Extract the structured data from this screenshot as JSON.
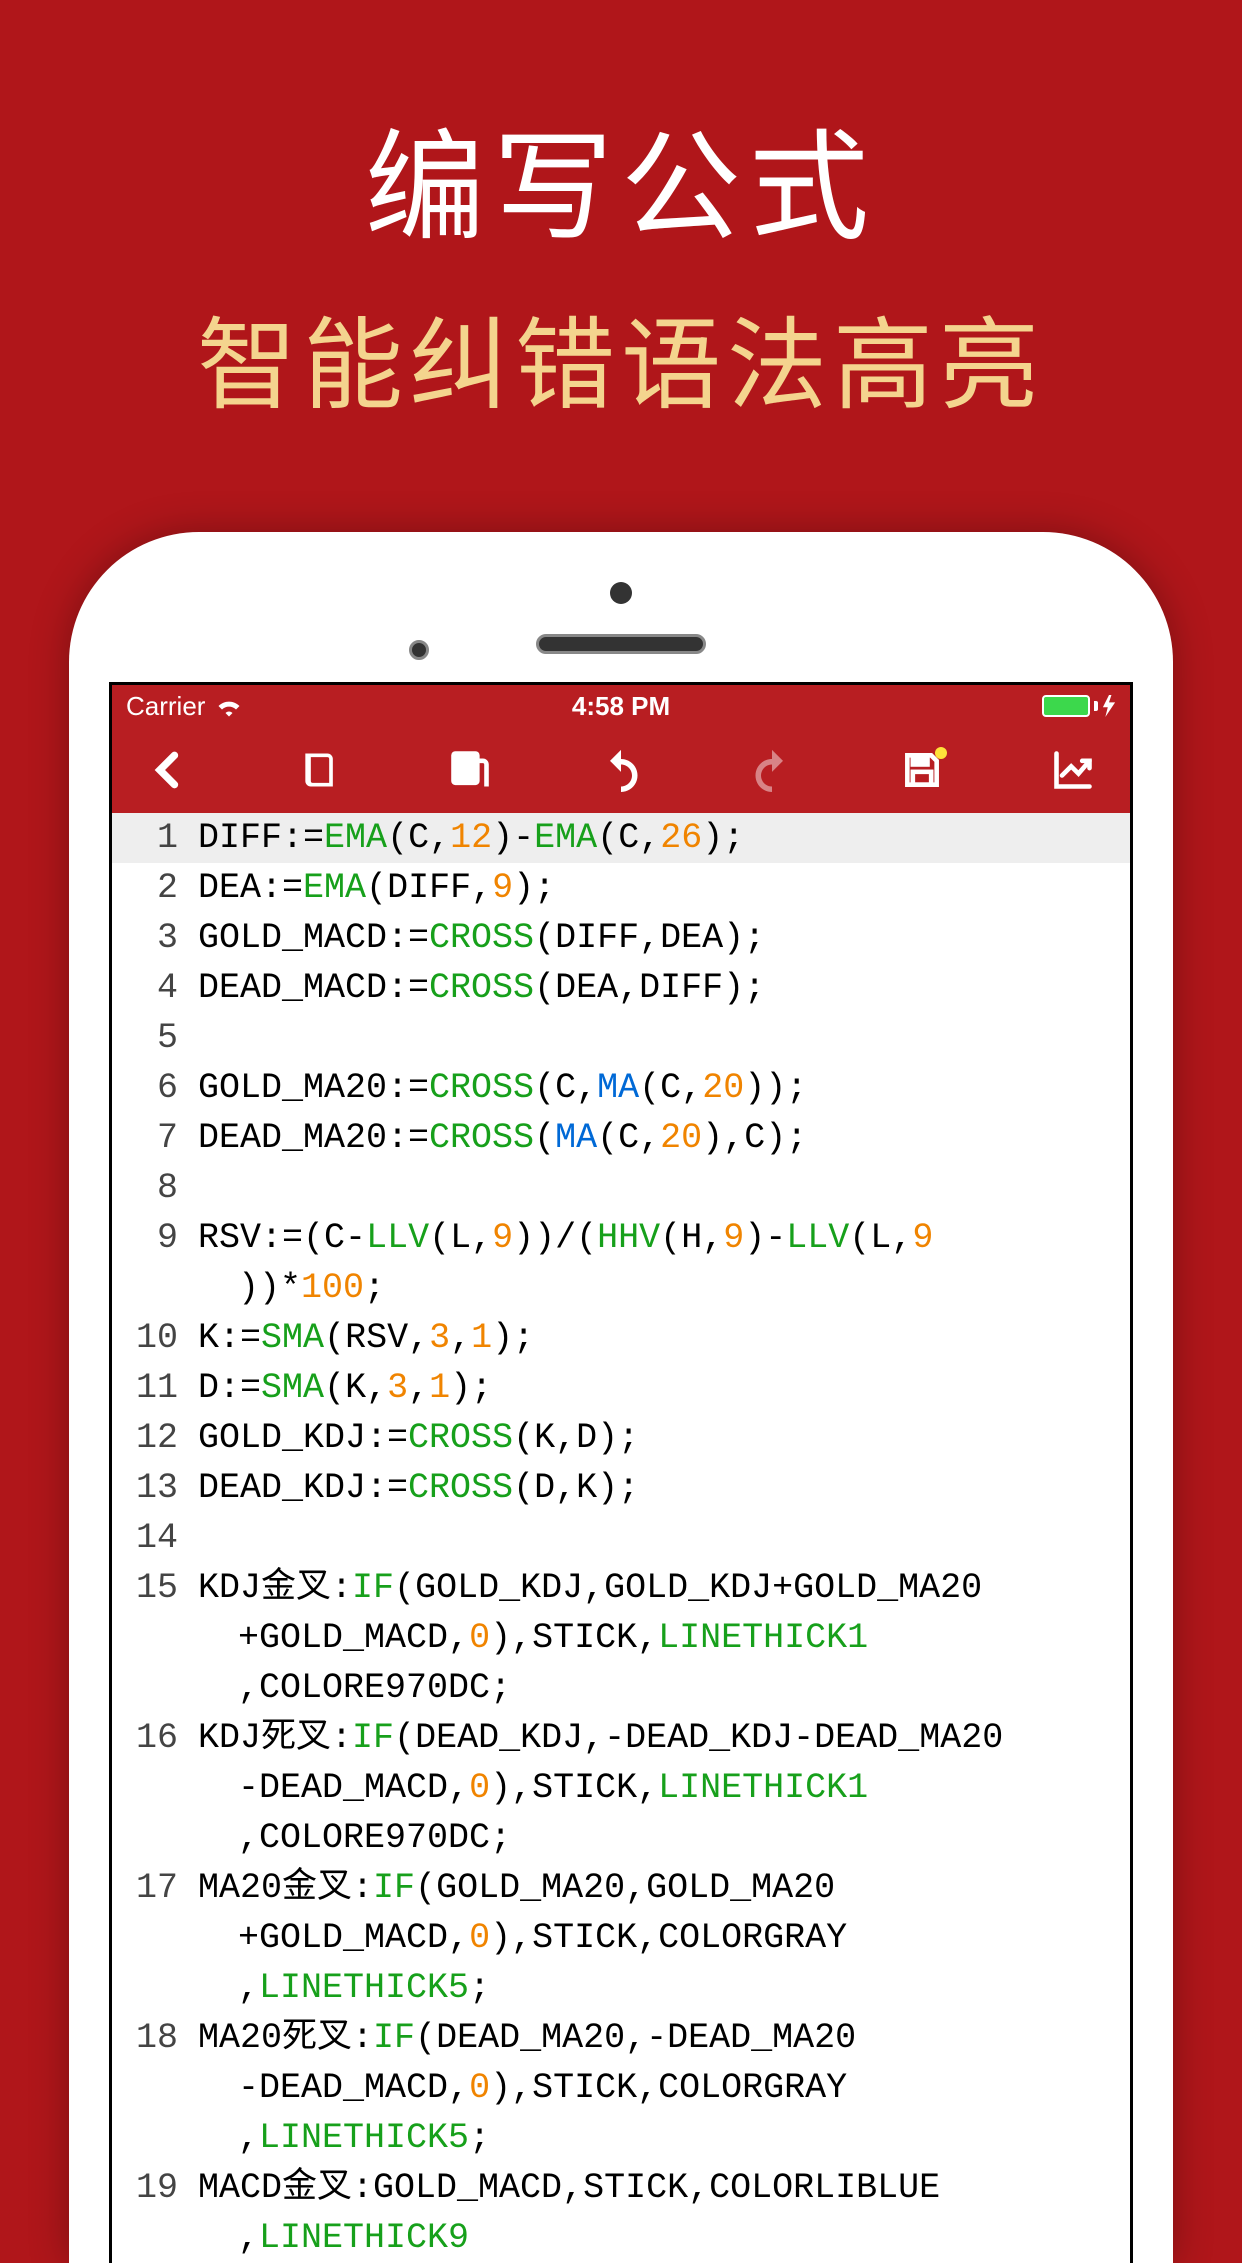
{
  "promo": {
    "title": "编写公式",
    "subtitle": "智能纠错语法高亮"
  },
  "status": {
    "carrier": "Carrier",
    "time": "4:58 PM"
  },
  "toolbar": {
    "back": "back-icon",
    "book": "book-icon",
    "copy": "copy-icon",
    "undo": "undo-icon",
    "redo": "redo-icon",
    "save": "save-icon",
    "chart": "chart-icon"
  },
  "code_lines": [
    {
      "n": 1,
      "active": true,
      "tokens": [
        {
          "t": "id",
          "v": "DIFF"
        },
        {
          "t": "punc",
          "v": ":"
        },
        {
          "t": "op",
          "v": "="
        },
        {
          "t": "fn",
          "v": "EMA"
        },
        {
          "t": "punc",
          "v": "("
        },
        {
          "t": "id",
          "v": "C"
        },
        {
          "t": "punc",
          "v": ","
        },
        {
          "t": "num",
          "v": "12"
        },
        {
          "t": "punc",
          "v": ")"
        },
        {
          "t": "op",
          "v": "-"
        },
        {
          "t": "fn",
          "v": "EMA"
        },
        {
          "t": "punc",
          "v": "("
        },
        {
          "t": "id",
          "v": "C"
        },
        {
          "t": "punc",
          "v": ","
        },
        {
          "t": "num",
          "v": "26"
        },
        {
          "t": "punc",
          "v": ");"
        }
      ]
    },
    {
      "n": 2,
      "tokens": [
        {
          "t": "id",
          "v": "DEA"
        },
        {
          "t": "punc",
          "v": ":="
        },
        {
          "t": "fn",
          "v": "EMA"
        },
        {
          "t": "punc",
          "v": "("
        },
        {
          "t": "id",
          "v": "DIFF"
        },
        {
          "t": "punc",
          "v": ","
        },
        {
          "t": "num",
          "v": "9"
        },
        {
          "t": "punc",
          "v": ");"
        }
      ]
    },
    {
      "n": 3,
      "tokens": [
        {
          "t": "id",
          "v": "GOLD_MACD"
        },
        {
          "t": "punc",
          "v": ":="
        },
        {
          "t": "fn",
          "v": "CROSS"
        },
        {
          "t": "punc",
          "v": "("
        },
        {
          "t": "id",
          "v": "DIFF"
        },
        {
          "t": "punc",
          "v": ","
        },
        {
          "t": "id",
          "v": "DEA"
        },
        {
          "t": "punc",
          "v": ");"
        }
      ]
    },
    {
      "n": 4,
      "tokens": [
        {
          "t": "id",
          "v": "DEAD_MACD"
        },
        {
          "t": "punc",
          "v": ":="
        },
        {
          "t": "fn",
          "v": "CROSS"
        },
        {
          "t": "punc",
          "v": "("
        },
        {
          "t": "id",
          "v": "DEA"
        },
        {
          "t": "punc",
          "v": ","
        },
        {
          "t": "id",
          "v": "DIFF"
        },
        {
          "t": "punc",
          "v": ");"
        }
      ]
    },
    {
      "n": 5,
      "tokens": []
    },
    {
      "n": 6,
      "tokens": [
        {
          "t": "id",
          "v": "GOLD_MA20"
        },
        {
          "t": "punc",
          "v": ":="
        },
        {
          "t": "fn",
          "v": "CROSS"
        },
        {
          "t": "punc",
          "v": "("
        },
        {
          "t": "id",
          "v": "C"
        },
        {
          "t": "punc",
          "v": ","
        },
        {
          "t": "var",
          "v": "MA"
        },
        {
          "t": "punc",
          "v": "("
        },
        {
          "t": "id",
          "v": "C"
        },
        {
          "t": "punc",
          "v": ","
        },
        {
          "t": "num",
          "v": "20"
        },
        {
          "t": "punc",
          "v": "));"
        }
      ]
    },
    {
      "n": 7,
      "tokens": [
        {
          "t": "id",
          "v": "DEAD_MA20"
        },
        {
          "t": "punc",
          "v": ":="
        },
        {
          "t": "fn",
          "v": "CROSS"
        },
        {
          "t": "punc",
          "v": "("
        },
        {
          "t": "var",
          "v": "MA"
        },
        {
          "t": "punc",
          "v": "("
        },
        {
          "t": "id",
          "v": "C"
        },
        {
          "t": "punc",
          "v": ","
        },
        {
          "t": "num",
          "v": "20"
        },
        {
          "t": "punc",
          "v": "),"
        },
        {
          "t": "id",
          "v": "C"
        },
        {
          "t": "punc",
          "v": ");"
        }
      ]
    },
    {
      "n": 8,
      "tokens": []
    },
    {
      "n": 9,
      "tokens": [
        {
          "t": "id",
          "v": "RSV"
        },
        {
          "t": "punc",
          "v": ":=("
        },
        {
          "t": "id",
          "v": "C"
        },
        {
          "t": "op",
          "v": "-"
        },
        {
          "t": "fn",
          "v": "LLV"
        },
        {
          "t": "punc",
          "v": "("
        },
        {
          "t": "id",
          "v": "L"
        },
        {
          "t": "punc",
          "v": ","
        },
        {
          "t": "num",
          "v": "9"
        },
        {
          "t": "punc",
          "v": "))/("
        },
        {
          "t": "fn",
          "v": "HHV"
        },
        {
          "t": "punc",
          "v": "("
        },
        {
          "t": "id",
          "v": "H"
        },
        {
          "t": "punc",
          "v": ","
        },
        {
          "t": "num",
          "v": "9"
        },
        {
          "t": "punc",
          "v": ")"
        },
        {
          "t": "op",
          "v": "-"
        },
        {
          "t": "fn",
          "v": "LLV"
        },
        {
          "t": "punc",
          "v": "("
        },
        {
          "t": "id",
          "v": "L"
        },
        {
          "t": "punc",
          "v": ","
        },
        {
          "t": "num",
          "v": "9"
        }
      ],
      "wrap": [
        {
          "t": "punc",
          "v": "))*"
        },
        {
          "t": "num",
          "v": "100"
        },
        {
          "t": "punc",
          "v": ";"
        }
      ]
    },
    {
      "n": 10,
      "tokens": [
        {
          "t": "id",
          "v": "K"
        },
        {
          "t": "punc",
          "v": ":="
        },
        {
          "t": "fn",
          "v": "SMA"
        },
        {
          "t": "punc",
          "v": "("
        },
        {
          "t": "id",
          "v": "RSV"
        },
        {
          "t": "punc",
          "v": ","
        },
        {
          "t": "num",
          "v": "3"
        },
        {
          "t": "punc",
          "v": ","
        },
        {
          "t": "num",
          "v": "1"
        },
        {
          "t": "punc",
          "v": ");"
        }
      ]
    },
    {
      "n": 11,
      "tokens": [
        {
          "t": "id",
          "v": "D"
        },
        {
          "t": "punc",
          "v": ":="
        },
        {
          "t": "fn",
          "v": "SMA"
        },
        {
          "t": "punc",
          "v": "("
        },
        {
          "t": "id",
          "v": "K"
        },
        {
          "t": "punc",
          "v": ","
        },
        {
          "t": "num",
          "v": "3"
        },
        {
          "t": "punc",
          "v": ","
        },
        {
          "t": "num",
          "v": "1"
        },
        {
          "t": "punc",
          "v": ");"
        }
      ]
    },
    {
      "n": 12,
      "tokens": [
        {
          "t": "id",
          "v": "GOLD_KDJ"
        },
        {
          "t": "punc",
          "v": ":="
        },
        {
          "t": "fn",
          "v": "CROSS"
        },
        {
          "t": "punc",
          "v": "("
        },
        {
          "t": "id",
          "v": "K"
        },
        {
          "t": "punc",
          "v": ","
        },
        {
          "t": "id",
          "v": "D"
        },
        {
          "t": "punc",
          "v": ");"
        }
      ]
    },
    {
      "n": 13,
      "tokens": [
        {
          "t": "id",
          "v": "DEAD_KDJ"
        },
        {
          "t": "punc",
          "v": ":="
        },
        {
          "t": "fn",
          "v": "CROSS"
        },
        {
          "t": "punc",
          "v": "("
        },
        {
          "t": "id",
          "v": "D"
        },
        {
          "t": "punc",
          "v": ","
        },
        {
          "t": "id",
          "v": "K"
        },
        {
          "t": "punc",
          "v": ");"
        }
      ]
    },
    {
      "n": 14,
      "tokens": []
    },
    {
      "n": 15,
      "tokens": [
        {
          "t": "id",
          "v": "KDJ金叉"
        },
        {
          "t": "punc",
          "v": ":"
        },
        {
          "t": "fn",
          "v": "IF"
        },
        {
          "t": "punc",
          "v": "("
        },
        {
          "t": "id",
          "v": "GOLD_KDJ"
        },
        {
          "t": "punc",
          "v": ","
        },
        {
          "t": "id",
          "v": "GOLD_KDJ"
        },
        {
          "t": "op",
          "v": "+"
        },
        {
          "t": "id",
          "v": "GOLD_MA20"
        }
      ],
      "wrap": [
        {
          "t": "op",
          "v": "+"
        },
        {
          "t": "id",
          "v": "GOLD_MACD"
        },
        {
          "t": "punc",
          "v": ","
        },
        {
          "t": "num",
          "v": "0"
        },
        {
          "t": "punc",
          "v": "),"
        },
        {
          "t": "id",
          "v": "STICK"
        },
        {
          "t": "punc",
          "v": ","
        },
        {
          "t": "fn",
          "v": "LINETHICK1"
        }
      ],
      "wrap2": [
        {
          "t": "punc",
          "v": ","
        },
        {
          "t": "id",
          "v": "COLORE970DC"
        },
        {
          "t": "punc",
          "v": ";"
        }
      ]
    },
    {
      "n": 16,
      "tokens": [
        {
          "t": "id",
          "v": "KDJ死叉"
        },
        {
          "t": "punc",
          "v": ":"
        },
        {
          "t": "fn",
          "v": "IF"
        },
        {
          "t": "punc",
          "v": "("
        },
        {
          "t": "id",
          "v": "DEAD_KDJ"
        },
        {
          "t": "punc",
          "v": ","
        },
        {
          "t": "op",
          "v": "-"
        },
        {
          "t": "id",
          "v": "DEAD_KDJ"
        },
        {
          "t": "op",
          "v": "-"
        },
        {
          "t": "id",
          "v": "DEAD_MA20"
        }
      ],
      "wrap": [
        {
          "t": "op",
          "v": "-"
        },
        {
          "t": "id",
          "v": "DEAD_MACD"
        },
        {
          "t": "punc",
          "v": ","
        },
        {
          "t": "num",
          "v": "0"
        },
        {
          "t": "punc",
          "v": "),"
        },
        {
          "t": "id",
          "v": "STICK"
        },
        {
          "t": "punc",
          "v": ","
        },
        {
          "t": "fn",
          "v": "LINETHICK1"
        }
      ],
      "wrap2": [
        {
          "t": "punc",
          "v": ","
        },
        {
          "t": "id",
          "v": "COLORE970DC"
        },
        {
          "t": "punc",
          "v": ";"
        }
      ]
    },
    {
      "n": 17,
      "tokens": [
        {
          "t": "id",
          "v": "MA20金叉"
        },
        {
          "t": "punc",
          "v": ":"
        },
        {
          "t": "fn",
          "v": "IF"
        },
        {
          "t": "punc",
          "v": "("
        },
        {
          "t": "id",
          "v": "GOLD_MA20"
        },
        {
          "t": "punc",
          "v": ","
        },
        {
          "t": "id",
          "v": "GOLD_MA20"
        }
      ],
      "wrap": [
        {
          "t": "op",
          "v": "+"
        },
        {
          "t": "id",
          "v": "GOLD_MACD"
        },
        {
          "t": "punc",
          "v": ","
        },
        {
          "t": "num",
          "v": "0"
        },
        {
          "t": "punc",
          "v": "),"
        },
        {
          "t": "id",
          "v": "STICK"
        },
        {
          "t": "punc",
          "v": ","
        },
        {
          "t": "id",
          "v": "COLORGRAY"
        }
      ],
      "wrap2": [
        {
          "t": "punc",
          "v": ","
        },
        {
          "t": "fn",
          "v": "LINETHICK5"
        },
        {
          "t": "punc",
          "v": ";"
        }
      ]
    },
    {
      "n": 18,
      "tokens": [
        {
          "t": "id",
          "v": "MA20死叉"
        },
        {
          "t": "punc",
          "v": ":"
        },
        {
          "t": "fn",
          "v": "IF"
        },
        {
          "t": "punc",
          "v": "("
        },
        {
          "t": "id",
          "v": "DEAD_MA20"
        },
        {
          "t": "punc",
          "v": ","
        },
        {
          "t": "op",
          "v": "-"
        },
        {
          "t": "id",
          "v": "DEAD_MA20"
        }
      ],
      "wrap": [
        {
          "t": "op",
          "v": "-"
        },
        {
          "t": "id",
          "v": "DEAD_MACD"
        },
        {
          "t": "punc",
          "v": ","
        },
        {
          "t": "num",
          "v": "0"
        },
        {
          "t": "punc",
          "v": "),"
        },
        {
          "t": "id",
          "v": "STICK"
        },
        {
          "t": "punc",
          "v": ","
        },
        {
          "t": "id",
          "v": "COLORGRAY"
        }
      ],
      "wrap2": [
        {
          "t": "punc",
          "v": ","
        },
        {
          "t": "fn",
          "v": "LINETHICK5"
        },
        {
          "t": "punc",
          "v": ";"
        }
      ]
    },
    {
      "n": 19,
      "tokens": [
        {
          "t": "id",
          "v": "MACD金叉"
        },
        {
          "t": "punc",
          "v": ":"
        },
        {
          "t": "id",
          "v": "GOLD_MACD"
        },
        {
          "t": "punc",
          "v": ","
        },
        {
          "t": "id",
          "v": "STICK"
        },
        {
          "t": "punc",
          "v": ","
        },
        {
          "t": "id",
          "v": "COLORLIBLUE"
        }
      ],
      "wrap": [
        {
          "t": "punc",
          "v": ","
        },
        {
          "t": "fn",
          "v": "LINETHICK9"
        }
      ]
    }
  ]
}
